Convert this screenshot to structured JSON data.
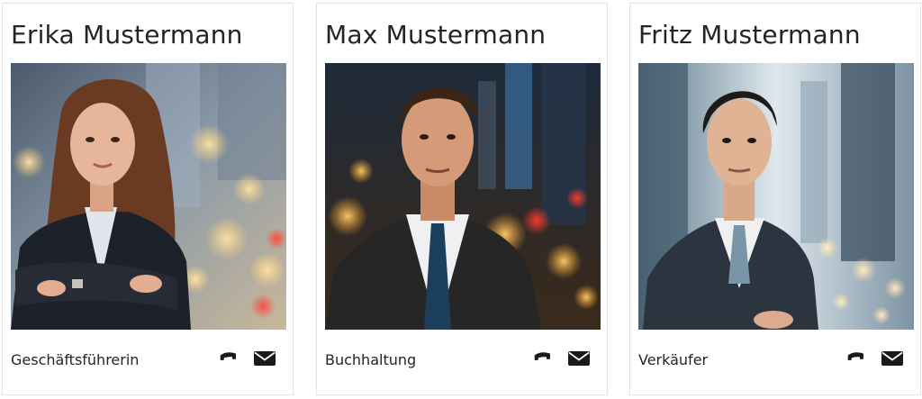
{
  "people": [
    {
      "name": "Erika Mustermann",
      "role": "Geschäftsführerin",
      "photo_icon": "portrait-woman",
      "phone_icon": "phone-icon",
      "email_icon": "envelope-icon"
    },
    {
      "name": "Max Mustermann",
      "role": "Buchhaltung",
      "photo_icon": "portrait-man",
      "phone_icon": "phone-icon",
      "email_icon": "envelope-icon"
    },
    {
      "name": "Fritz Mustermann",
      "role": "Verkäufer",
      "photo_icon": "portrait-man",
      "phone_icon": "phone-icon",
      "email_icon": "envelope-icon"
    }
  ],
  "colors": {
    "text": "#212529",
    "border": "#e3e3e3",
    "icon": "#1a1a1a"
  }
}
